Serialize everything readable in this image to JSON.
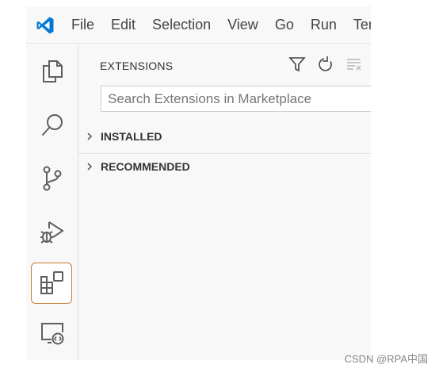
{
  "menu": [
    "File",
    "Edit",
    "Selection",
    "View",
    "Go",
    "Run",
    "Ter"
  ],
  "activity_bar": {
    "items": [
      {
        "icon": "explorer-icon"
      },
      {
        "icon": "search-icon"
      },
      {
        "icon": "source-control-icon"
      },
      {
        "icon": "run-debug-icon"
      },
      {
        "icon": "extensions-icon",
        "active": true
      },
      {
        "icon": "remote-explorer-icon"
      }
    ]
  },
  "sidebar": {
    "title": "EXTENSIONS",
    "actions": [
      "filter-icon",
      "refresh-icon",
      "clear-icon"
    ],
    "search_placeholder": "Search Extensions in Marketplace",
    "sections": [
      {
        "label": "INSTALLED",
        "expanded": false
      },
      {
        "label": "RECOMMENDED",
        "expanded": false
      }
    ]
  },
  "watermark": "CSDN @RPA中国",
  "colors": {
    "accent": "#0078d4",
    "active_border": "#c97b30",
    "background": "#f8f8f8"
  }
}
